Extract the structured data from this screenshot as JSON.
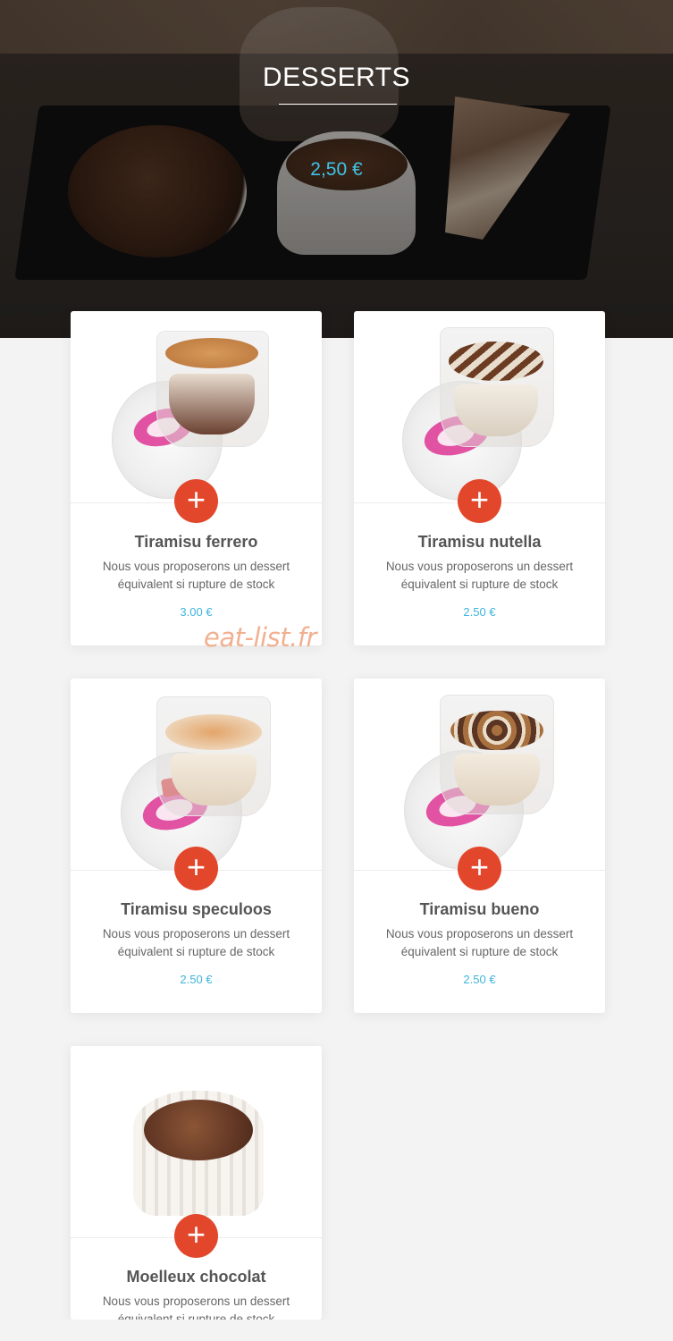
{
  "hero": {
    "title": "DESSERTS",
    "price": "2,50 €"
  },
  "cards": [
    {
      "name": "Tiramisu ferrero",
      "description": "Nous vous proposerons un dessert équivalent si rupture de stock",
      "price": "3.00 €",
      "add_icon": "plus-icon"
    },
    {
      "name": "Tiramisu nutella",
      "description": "Nous vous proposerons un dessert équivalent si rupture de stock",
      "price": "2.50 €",
      "add_icon": "plus-icon"
    },
    {
      "name": "Tiramisu speculoos",
      "description": "Nous vous proposerons un dessert équivalent si rupture de stock",
      "price": "2.50 €",
      "add_icon": "plus-icon"
    },
    {
      "name": "Tiramisu bueno",
      "description": "Nous vous proposerons un dessert équivalent si rupture de stock",
      "price": "2.50 €",
      "add_icon": "plus-icon"
    },
    {
      "name": "Moelleux chocolat",
      "description": "Nous vous proposerons un dessert équivalent si rupture de stock",
      "price": "",
      "add_icon": "plus-icon"
    }
  ],
  "add_symbol": "+",
  "watermark": "eat-list.fr",
  "colors": {
    "accent_red": "#e2472c",
    "price_blue": "#3fb5dc",
    "background": "#f3f3f3"
  }
}
